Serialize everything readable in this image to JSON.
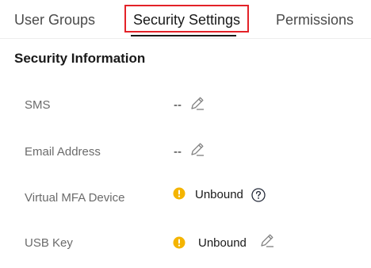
{
  "tabs": [
    {
      "label": "User Groups"
    },
    {
      "label": "Security Settings"
    },
    {
      "label": "Permissions"
    }
  ],
  "section": {
    "title": "Security Information"
  },
  "rows": [
    {
      "label": "SMS",
      "value": "--"
    },
    {
      "label": "Email Address",
      "value": "--"
    },
    {
      "label": "Virtual MFA Device",
      "value": "Unbound"
    },
    {
      "label": "USB Key",
      "value": "Unbound"
    }
  ],
  "colors": {
    "highlight_border": "#e32228",
    "warning": "#f4b400",
    "icon_gray": "#808080"
  },
  "icons": {
    "edit": "pencil-edit",
    "warning": "exclamation-circle",
    "help": "question-circle"
  }
}
